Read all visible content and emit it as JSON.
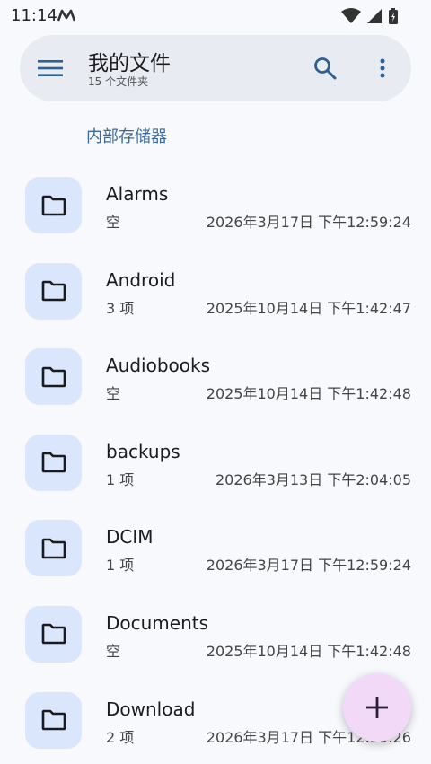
{
  "status": {
    "time": "11:14"
  },
  "appbar": {
    "title": "我的文件",
    "subtitle": "15 个文件夹"
  },
  "breadcrumb": "内部存储器",
  "folders": [
    {
      "name": "Alarms",
      "count": "空",
      "date": "2026年3月17日 下午12:59:24"
    },
    {
      "name": "Android",
      "count": "3 项",
      "date": "2025年10月14日 下午1:42:47"
    },
    {
      "name": "Audiobooks",
      "count": "空",
      "date": "2025年10月14日 下午1:42:48"
    },
    {
      "name": "backups",
      "count": "1 项",
      "date": "2026年3月13日 下午2:04:05"
    },
    {
      "name": "DCIM",
      "count": "1 项",
      "date": "2026年3月17日 下午12:59:24"
    },
    {
      "name": "Documents",
      "count": "空",
      "date": "2025年10月14日 下午1:42:48"
    },
    {
      "name": "Download",
      "count": "2 项",
      "date": "2026年3月17日 下午12:59:26"
    }
  ],
  "icons": {
    "menu": "menu-icon",
    "search": "search-icon",
    "more": "more-vert-icon",
    "folder": "folder-icon",
    "add": "add-icon"
  },
  "colors": {
    "accent": "#3a6a9e",
    "folder_tile": "#d9e6fb",
    "fab": "#f2d9f8"
  }
}
